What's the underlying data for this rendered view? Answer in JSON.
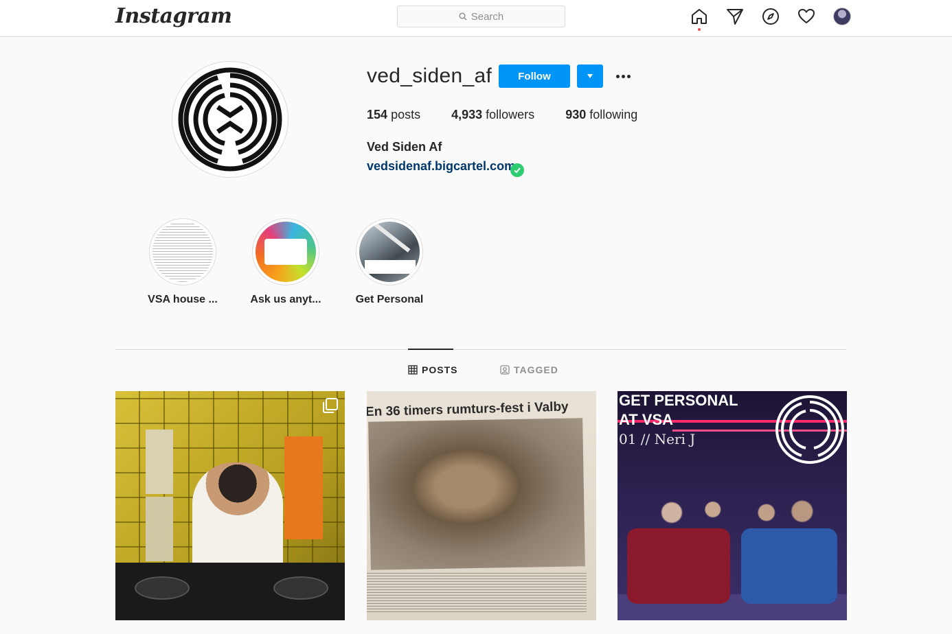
{
  "topbar": {
    "logo": "Instagram",
    "search_placeholder": "Search",
    "icons": [
      "home-icon",
      "direct-icon",
      "explore-icon",
      "activity-icon",
      "avatar"
    ]
  },
  "profile": {
    "username": "ved_siden_af",
    "follow_label": "Follow",
    "stats": {
      "posts_count": "154",
      "posts_label": "posts",
      "followers_count": "4,933",
      "followers_label": "followers",
      "following_count": "930",
      "following_label": "following"
    },
    "full_name": "Ved Siden Af",
    "website": "vedsidenaf.bigcartel.com"
  },
  "highlights": [
    {
      "label": "VSA house ..."
    },
    {
      "label": "Ask us anyt..."
    },
    {
      "label": "Get Personal"
    }
  ],
  "tabs": {
    "posts": "POSTS",
    "tagged": "TAGGED"
  },
  "posts": {
    "post2_headline": "En 36 timers rumturs-fest i Valby",
    "post3_title_line1": "GET PERSONAL",
    "post3_title_line2": "AT VSA",
    "post3_subtitle": "01  //  Neri J"
  },
  "colors": {
    "accent": "#0095f6",
    "link": "#00376b",
    "verified": "#2ecc71",
    "notification_dot": "#ed4956"
  }
}
